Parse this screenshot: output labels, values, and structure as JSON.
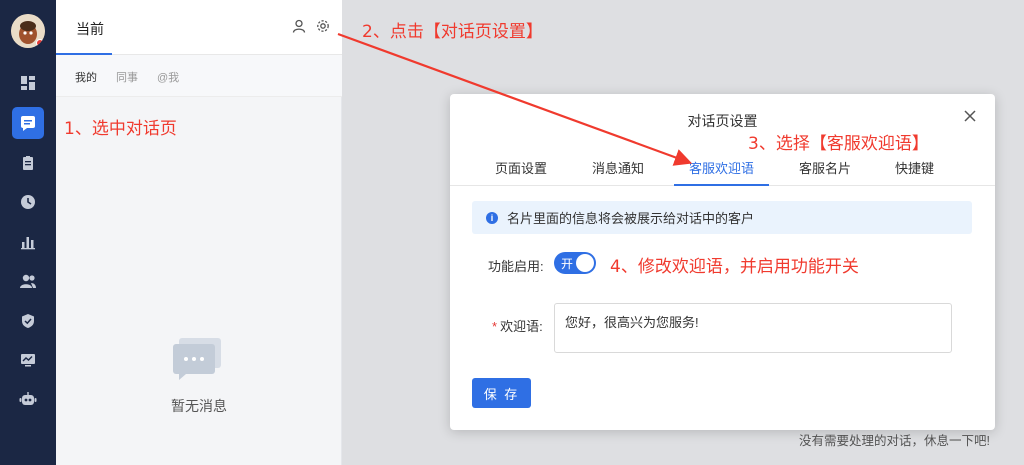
{
  "panel": {
    "tab": "当前",
    "subtabs": [
      "我的",
      "同事",
      "@我"
    ],
    "empty_text": "暂无消息"
  },
  "main": {
    "hint": "没有需要处理的对话，休息一下吧!"
  },
  "dialog": {
    "title": "对话页设置",
    "tabs": [
      "页面设置",
      "消息通知",
      "客服欢迎语",
      "客服名片",
      "快捷键"
    ],
    "active_tab": "客服欢迎语",
    "info": "名片里面的信息将会被展示给对话中的客户",
    "enable_label": "功能启用:",
    "switch_text": "开",
    "switch_on": true,
    "welcome_label": "欢迎语:",
    "welcome_value": "您好，很高兴为您服务!",
    "save_label": "保 存"
  },
  "annotations": {
    "step1": "1、选中对话页",
    "step2": "2、点击【对话页设置】",
    "step3": "3、选择【客服欢迎语】",
    "step4": "4、修改欢迎语，并启用功能开关"
  },
  "colors": {
    "accent": "#2f6fe4",
    "nav_bg": "#1b2744",
    "annotation": "#f03a2e"
  }
}
